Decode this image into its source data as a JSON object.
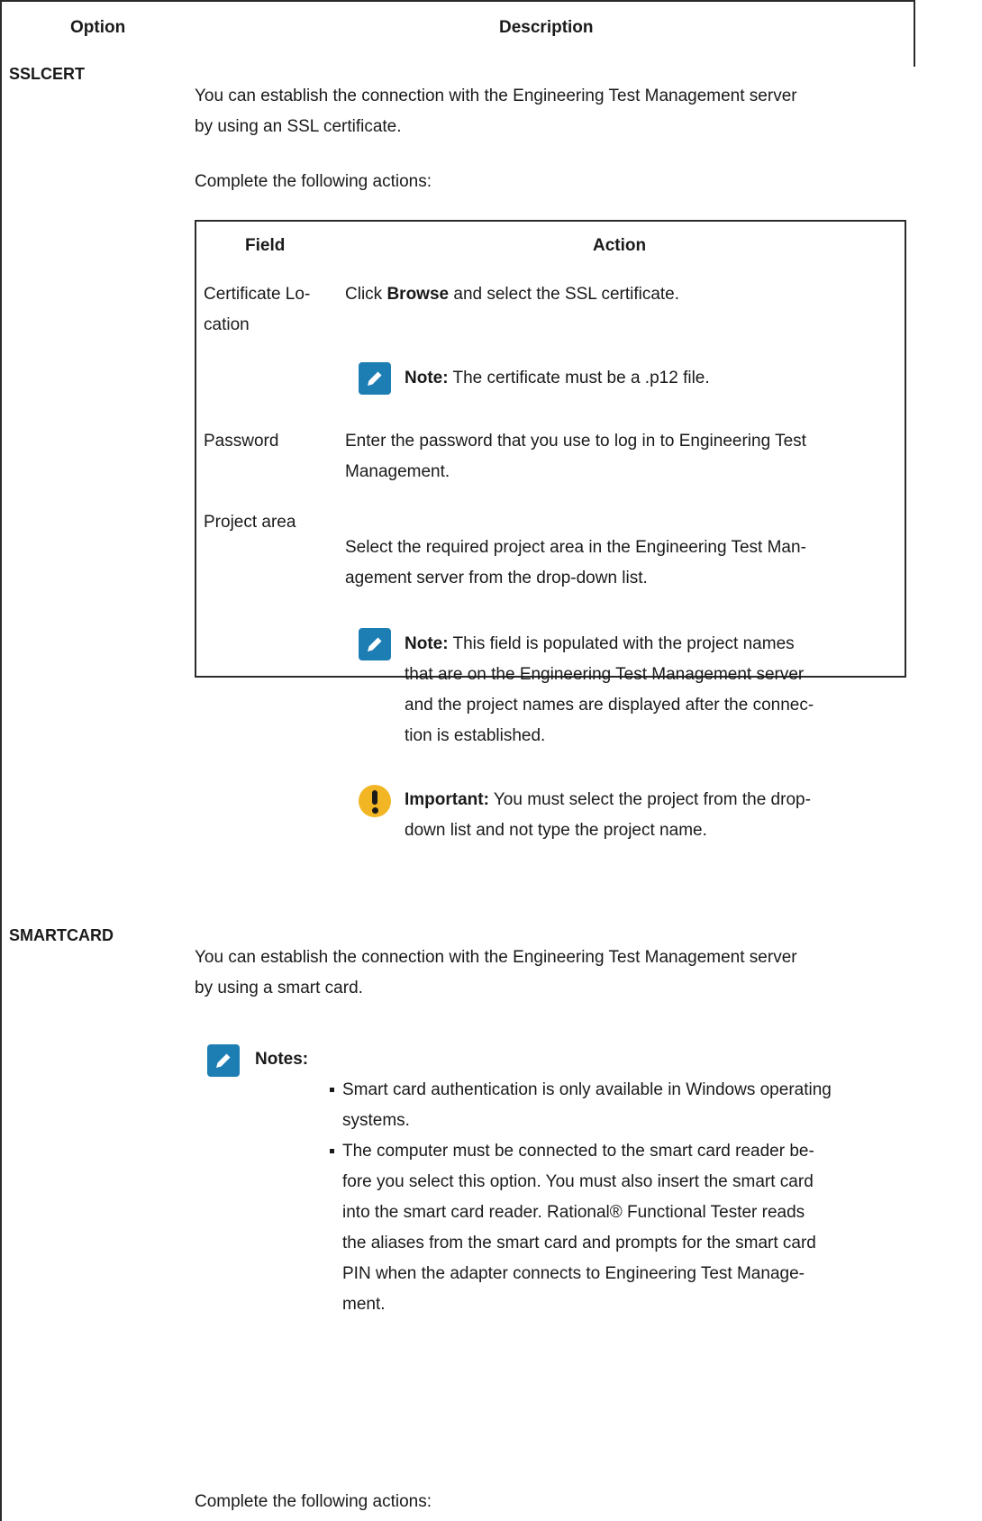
{
  "table": {
    "header_option": "Option",
    "header_description": "Description"
  },
  "sslcert": {
    "option": "SSLCERT",
    "intro_line1": "You can establish the connection with the Engineering Test Management server",
    "intro_line2": "by using an SSL certificate.",
    "complete": "Complete the following actions:",
    "inner_table": {
      "header_field": "Field",
      "header_action": "Action",
      "row1_field_line1": "Certificate Lo-",
      "row1_field_line2": "cation",
      "row1_action_pre": "Click ",
      "row1_action_bold": "Browse",
      "row1_action_post": " and select the SSL certificate.",
      "row1_note_label": "Note:",
      "row1_note_text": " The certificate must be a .p12 file.",
      "row2_field": "Password",
      "row2_action_line1": "Enter the password that you use to log in to Engineering Test",
      "row2_action_line2": "Management.",
      "row3_field": "Project area",
      "row3_action_line1": "Select the required project area in the Engineering Test Man-",
      "row3_action_line2": "agement server from the drop-down list.",
      "row3_note_label": "Note:",
      "row3_note_line1": " This field is populated with the project names",
      "row3_note_line2": "that are on the Engineering Test Management server",
      "row3_note_line3": "and the project names are displayed after the connec-",
      "row3_note_line4": "tion is established.",
      "row3_imp_label": "Important:",
      "row3_imp_line1": " You must select the project from the drop-",
      "row3_imp_line2": "down list and not type the project name."
    }
  },
  "smartcard": {
    "option": "SMARTCARD",
    "intro_line1": "You can establish the connection with the Engineering Test Management server",
    "intro_line2": "by using a smart card.",
    "notes_label": "Notes:",
    "note1_line1": "Smart card authentication is only available in Windows operating",
    "note1_line2": "systems.",
    "note2_line1": "The computer must be connected to the smart card reader be-",
    "note2_line2": "fore you select this option. You must also insert the smart card",
    "note2_line3": "into the smart card reader. Rational® Functional Tester reads",
    "note2_line4": "the aliases from the smart card and prompts for the smart card",
    "note2_line5": "PIN when the adapter connects to Engineering Test Manage-",
    "note2_line6": "ment.",
    "complete": "Complete the following actions:"
  },
  "icons": {
    "note": "pencil-note-icon",
    "important": "exclamation-important-icon",
    "note_color": "#1d7eb4",
    "important_color": "#f2b624"
  }
}
